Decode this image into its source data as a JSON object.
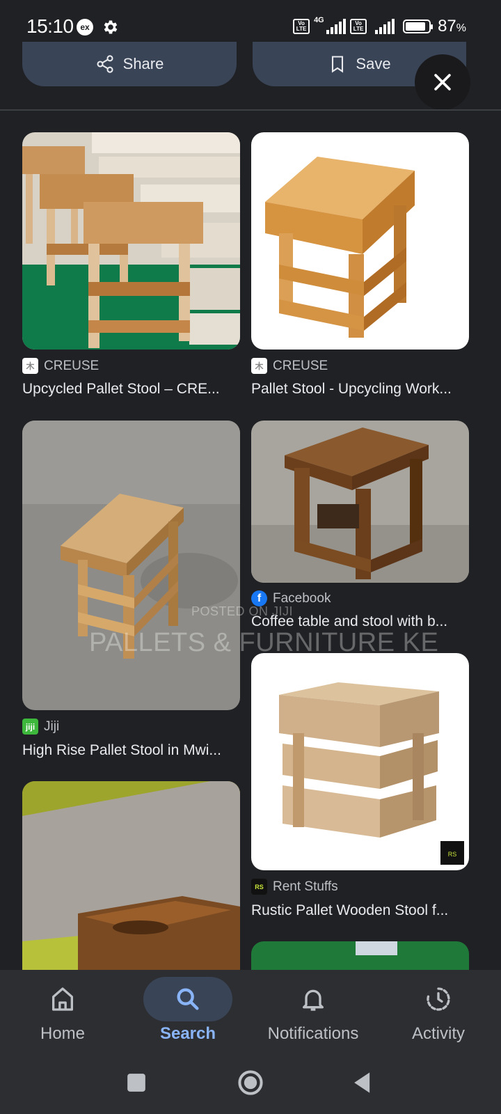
{
  "status_bar": {
    "time": "15:10",
    "ex_badge": "ex",
    "net_type": "4G",
    "volte_label": "Vo LTE",
    "battery_pct": "87",
    "battery_pct_suffix": "%",
    "battery_level": 0.87
  },
  "actions": {
    "share_label": "Share",
    "save_label": "Save"
  },
  "results": [
    {
      "source": "CREUSE",
      "title": "Upcycled Pallet Stool – CRE...",
      "favicon": "creuse-icon"
    },
    {
      "source": "CREUSE",
      "title": "Pallet Stool - Upcycling Work...",
      "favicon": "creuse-icon"
    },
    {
      "source": "Jiji",
      "title": "High Rise Pallet Stool in Mwi...",
      "favicon": "jiji-icon"
    },
    {
      "source": "Facebook",
      "title": "Coffee table and stool with b...",
      "favicon": "facebook-icon"
    },
    {
      "source": "Rent Stuffs",
      "title": "Rustic Pallet Wooden Stool f...",
      "favicon": "rentstuffs-icon"
    }
  ],
  "watermark": {
    "line1": "POSTED ON JIJI",
    "line2": "PALLETS & FURNITURE KE"
  },
  "bottom_nav": [
    {
      "label": "Home",
      "icon": "home-icon"
    },
    {
      "label": "Search",
      "icon": "search-icon",
      "active": true
    },
    {
      "label": "Notifications",
      "icon": "bell-icon"
    },
    {
      "label": "Activity",
      "icon": "activity-icon"
    }
  ],
  "colors": {
    "background": "#202124",
    "pill": "#394457",
    "accent": "#8ab4f8",
    "nav_bg": "#2d2e31"
  }
}
